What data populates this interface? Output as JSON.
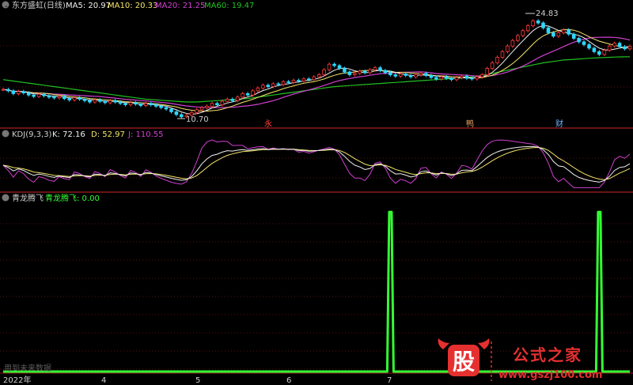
{
  "colors": {
    "background": "#000000",
    "divider": "#8b1a1a",
    "grid": "#5a1010",
    "up_candle": "#ff3b3b",
    "down_candle": "#2ed8ff",
    "ma5": "#f0f0f0",
    "ma10": "#f5e56b",
    "ma20": "#d040d0",
    "ma60": "#22c022",
    "kdj_k": "#f0f0f0",
    "kdj_d": "#f5e56b",
    "kdj_j": "#d040d0",
    "signal": "#33ff33",
    "badge": "#777777"
  },
  "main_panel": {
    "title": "东方盛虹(日线)",
    "ma_labels": [
      {
        "text": "MA5: 20.97",
        "color": "#f0f0f0"
      },
      {
        "text": "MA10: 20.33",
        "color": "#f5e56b"
      },
      {
        "text": "MA20: 21.25",
        "color": "#d040d0"
      },
      {
        "text": "MA60: 19.47",
        "color": "#22c022"
      }
    ],
    "high_label": "24.83",
    "low_label": "10.70",
    "event_markers": [
      {
        "text": "永",
        "color": "#ff4040"
      },
      {
        "text": "鸭",
        "color": "#e0a060"
      },
      {
        "text": "财",
        "color": "#6fb0ff"
      }
    ]
  },
  "kdj_panel": {
    "title": "KDJ(9,3,3)",
    "labels": [
      {
        "text": "K: 72.16",
        "color": "#f0f0f0"
      },
      {
        "text": "D: 52.97",
        "color": "#f5e56b"
      },
      {
        "text": "J: 110.55",
        "color": "#d040d0"
      }
    ]
  },
  "signal_panel": {
    "title": "青龙腾飞",
    "series_label": "青龙腾飞: 0.00",
    "footer_note": "用到未来数据"
  },
  "x_axis": {
    "labels": [
      "2022年",
      "4",
      "5",
      "6",
      "7"
    ]
  },
  "watermark": {
    "logo_char": "股",
    "name": "公式之家",
    "url": "www.gszj100.com"
  },
  "chart_data": [
    {
      "type": "line",
      "title": "东方盛虹(日线)",
      "series": [
        {
          "name": "MA5",
          "last": 20.97
        },
        {
          "name": "MA10",
          "last": 20.33
        },
        {
          "name": "MA20",
          "last": 21.25
        },
        {
          "name": "MA60",
          "last": 19.47
        }
      ],
      "annotations": [
        {
          "text": "24.83",
          "meaning": "period high"
        },
        {
          "text": "10.70",
          "meaning": "period low"
        }
      ],
      "ylim": [
        9.5,
        26
      ],
      "x_tick_labels": [
        "2022年",
        "4",
        "5",
        "6",
        "7"
      ],
      "close": [
        14.8,
        14.6,
        14.2,
        14.5,
        14.3,
        14.0,
        13.8,
        14.1,
        13.9,
        13.7,
        13.6,
        13.8,
        13.5,
        13.3,
        13.6,
        13.4,
        13.2,
        13.0,
        13.3,
        13.1,
        12.9,
        13.2,
        13.0,
        12.8,
        12.6,
        12.9,
        12.7,
        12.5,
        12.8,
        12.6,
        12.4,
        12.2,
        12.0,
        11.6,
        11.2,
        10.9,
        11.1,
        11.5,
        11.9,
        12.2,
        12.4,
        12.8,
        12.6,
        13.1,
        13.4,
        13.2,
        13.7,
        14.2,
        14.0,
        14.6,
        15.0,
        15.4,
        15.2,
        15.6,
        15.5,
        15.9,
        15.8,
        16.1,
        16.0,
        16.3,
        16.2,
        16.6,
        16.9,
        17.6,
        18.4,
        18.2,
        17.8,
        17.3,
        16.9,
        17.1,
        17.4,
        17.2,
        17.6,
        17.9,
        17.5,
        17.2,
        16.9,
        16.7,
        17.0,
        16.8,
        16.6,
        16.9,
        17.1,
        16.8,
        16.5,
        16.3,
        16.6,
        16.4,
        16.2,
        16.5,
        16.7,
        16.4,
        16.3,
        16.6,
        16.9,
        17.8,
        18.6,
        19.4,
        20.2,
        21.0,
        21.8,
        22.5,
        23.2,
        23.9,
        24.6,
        24.3,
        23.6,
        22.9,
        22.4,
        22.9,
        23.3,
        22.7,
        22.1,
        21.6,
        21.2,
        20.7,
        20.2,
        19.8,
        20.4,
        21.0,
        21.4,
        20.9,
        20.6,
        20.97
      ],
      "ma60": [
        16.2,
        16.1,
        16.0,
        15.9,
        15.8,
        15.7,
        15.6,
        15.5,
        15.4,
        15.3,
        15.2,
        15.1,
        15.0,
        14.9,
        14.8,
        14.7,
        14.6,
        14.5,
        14.4,
        14.3,
        14.2,
        14.1,
        14.0,
        13.9,
        13.8,
        13.7,
        13.6,
        13.5,
        13.4,
        13.35,
        13.3,
        13.25,
        13.2,
        13.15,
        13.1,
        13.05,
        13.0,
        13.0,
        13.0,
        13.05,
        13.1,
        13.15,
        13.2,
        13.25,
        13.3,
        13.35,
        13.4,
        13.45,
        13.5,
        13.6,
        13.7,
        13.8,
        13.9,
        14.0,
        14.1,
        14.2,
        14.3,
        14.4,
        14.5,
        14.6,
        14.7,
        14.8,
        14.9,
        15.0,
        15.1,
        15.2,
        15.25,
        15.3,
        15.35,
        15.4,
        15.45,
        15.5,
        15.55,
        15.6,
        15.65,
        15.7,
        15.75,
        15.8,
        15.85,
        15.9,
        15.95,
        16.0,
        16.05,
        16.1,
        16.15,
        16.2,
        16.25,
        16.3,
        16.35,
        16.4,
        16.45,
        16.5,
        16.6,
        16.7,
        16.8,
        16.95,
        17.1,
        17.25,
        17.4,
        17.55,
        17.7,
        17.85,
        18.0,
        18.15,
        18.3,
        18.45,
        18.6,
        18.7,
        18.8,
        18.9,
        19.0,
        19.05,
        19.1,
        19.15,
        19.2,
        19.25,
        19.3,
        19.33,
        19.36,
        19.39,
        19.42,
        19.44,
        19.46,
        19.47
      ]
    },
    {
      "type": "line",
      "title": "KDJ(9,3,3)",
      "series": [
        {
          "name": "K",
          "last": 72.16
        },
        {
          "name": "D",
          "last": 52.97
        },
        {
          "name": "J",
          "last": 110.55
        }
      ],
      "ylim": [
        -10,
        110
      ]
    },
    {
      "type": "line",
      "title": "青龙腾飞",
      "series": [
        {
          "name": "青龙腾飞",
          "last": 0.0,
          "spikes_at_index": [
            76,
            117
          ],
          "spike_value": 1
        }
      ],
      "ylim": [
        0,
        1.05
      ]
    }
  ]
}
